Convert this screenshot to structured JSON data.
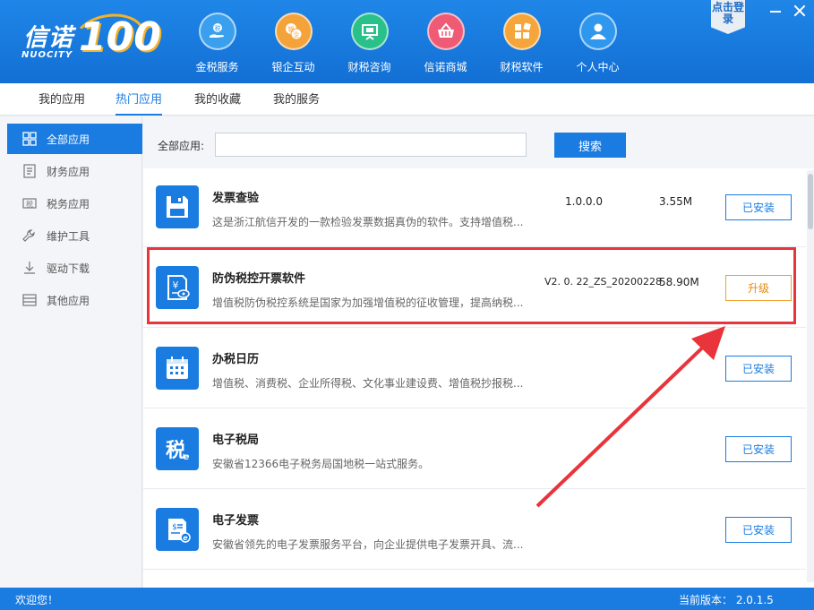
{
  "header": {
    "logo_cn": "信诺",
    "logo_num": "100",
    "logo_en": "NUOCITY",
    "login_label": "点击登录",
    "nav": [
      {
        "label": "金税服务",
        "icon": "hand-service-icon",
        "color": "#3aa0ee"
      },
      {
        "label": "银企互动",
        "icon": "bank-enterprise-icon",
        "color": "#f3a33a"
      },
      {
        "label": "财税咨询",
        "icon": "presentation-board-icon",
        "color": "#29c08a"
      },
      {
        "label": "信诺商城",
        "icon": "shopping-basket-icon",
        "color": "#ef5a74"
      },
      {
        "label": "财税软件",
        "icon": "app-grid-icon",
        "color": "#f5a53a"
      },
      {
        "label": "个人中心",
        "icon": "user-icon",
        "color": "#2f98ee"
      }
    ]
  },
  "tabs": [
    "我的应用",
    "热门应用",
    "我的收藏",
    "我的服务"
  ],
  "active_tab": "热门应用",
  "sidebar": [
    {
      "label": "全部应用",
      "icon": "grid-icon"
    },
    {
      "label": "财务应用",
      "icon": "finance-doc-icon"
    },
    {
      "label": "税务应用",
      "icon": "tax-icon"
    },
    {
      "label": "维护工具",
      "icon": "wrench-icon"
    },
    {
      "label": "驱动下载",
      "icon": "download-icon"
    },
    {
      "label": "其他应用",
      "icon": "list-icon"
    }
  ],
  "search": {
    "label": "全部应用:",
    "value": "",
    "button": "搜索"
  },
  "apps": [
    {
      "title": "发票查验",
      "desc": "这是浙江航信开发的一款检验发票数据真伪的软件。支持增值税...",
      "version": "1.0.0.0",
      "size": "3.55M",
      "button": "已安装",
      "status": "installed",
      "icon": "floppy-disk-icon"
    },
    {
      "title": "防伪税控开票软件",
      "desc": "增值税防伪税控系统是国家为加强增值税的征收管理，提高纳税...",
      "version": "V2. 0. 22_ZS_20200228",
      "size": "58.90M",
      "button": "升级",
      "status": "upgrade",
      "icon": "invoice-yuan-icon"
    },
    {
      "title": "办税日历",
      "desc": "增值税、消费税、企业所得税、文化事业建设费、增值税抄报税...",
      "version": "",
      "size": "",
      "button": "已安装",
      "status": "installed",
      "icon": "calendar-icon"
    },
    {
      "title": "电子税局",
      "desc": "安徽省12366电子税务局国地税一站式服务。",
      "version": "",
      "size": "",
      "button": "已安装",
      "status": "installed",
      "icon": "e-tax-icon"
    },
    {
      "title": "电子发票",
      "desc": "安徽省领先的电子发票服务平台，向企业提供电子发票开具、流...",
      "version": "",
      "size": "",
      "button": "已安装",
      "status": "installed",
      "icon": "e-invoice-icon"
    }
  ],
  "status": {
    "left": "欢迎您！",
    "right": "当前版本： 2.0.1.5"
  },
  "colors": {
    "primary": "#1a7ce0",
    "highlight": "#e8343a",
    "upgrade": "#e88a10"
  }
}
